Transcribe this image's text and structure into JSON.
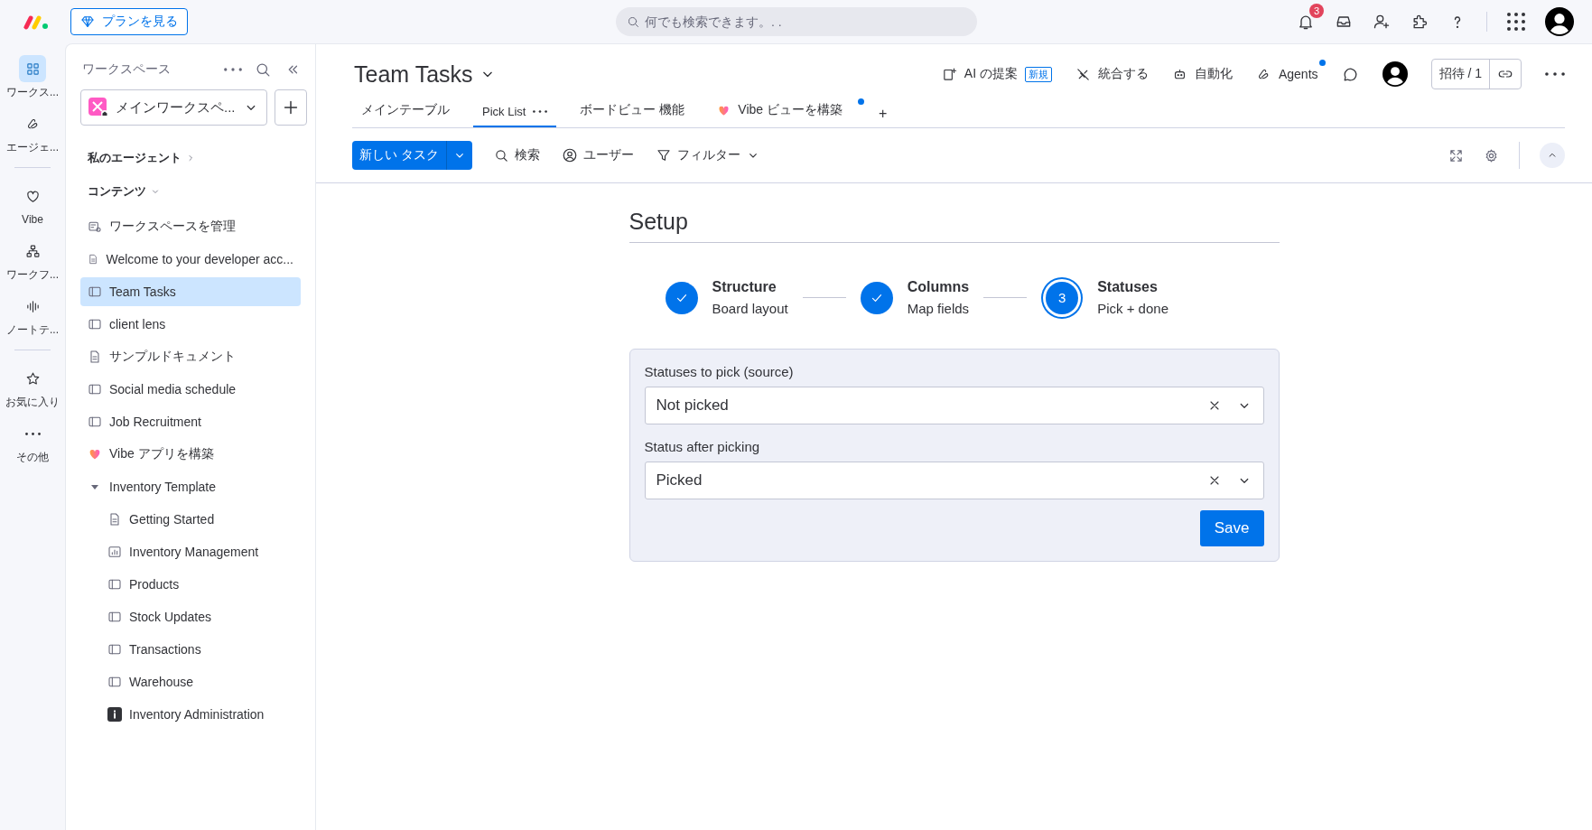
{
  "topbar": {
    "plans_button": "プランを見る",
    "search": {
      "placeholder": "何でも検索できます。. ."
    },
    "notification_count": "3"
  },
  "rail": [
    {
      "label": "ワークス...",
      "kind": "workspace",
      "selected": true
    },
    {
      "label": "エージェ...",
      "kind": "agents",
      "selected": false
    },
    {
      "label": "Vibe",
      "kind": "vibe",
      "selected": false
    },
    {
      "label": "ワークフ...",
      "kind": "workflows",
      "selected": false
    },
    {
      "label": "ノートテ...",
      "kind": "notetaker",
      "selected": false
    },
    {
      "label": "お気に入り",
      "kind": "favorites",
      "selected": false
    },
    {
      "label": "その他",
      "kind": "more",
      "selected": false
    }
  ],
  "sidebar": {
    "title": "ワークスペース",
    "workspace": "メインワークスペ...",
    "sections": [
      {
        "label": "私のエージェント",
        "expanded": false
      },
      {
        "label": "コンテンツ",
        "expanded": true
      }
    ],
    "items": [
      {
        "label": "ワークスペースを管理",
        "kind": "manage",
        "selected": false
      },
      {
        "label": "Welcome to your developer acc...",
        "kind": "doc",
        "selected": false
      },
      {
        "label": "Team Tasks",
        "kind": "board",
        "selected": true
      },
      {
        "label": "client lens",
        "kind": "board",
        "selected": false
      },
      {
        "label": "サンプルドキュメント",
        "kind": "doc",
        "selected": false
      },
      {
        "label": "Social media schedule",
        "kind": "board",
        "selected": false
      },
      {
        "label": "Job Recruitment",
        "kind": "board",
        "selected": false
      },
      {
        "label": "Vibe アプリを構築",
        "kind": "vibe",
        "selected": false
      },
      {
        "label": "Inventory Template",
        "kind": "folder",
        "selected": false,
        "expanded": true,
        "children": [
          {
            "label": "Getting Started",
            "kind": "doc",
            "selected": false
          },
          {
            "label": "Inventory Management",
            "kind": "dashboard",
            "selected": false
          },
          {
            "label": "Products",
            "kind": "board",
            "selected": false
          },
          {
            "label": "Stock Updates",
            "kind": "board",
            "selected": false
          },
          {
            "label": "Transactions",
            "kind": "board",
            "selected": false
          },
          {
            "label": "Warehouse",
            "kind": "board",
            "selected": false
          },
          {
            "label": "Inventory Administration",
            "kind": "app",
            "selected": false
          }
        ]
      }
    ]
  },
  "header": {
    "title": "Team Tasks",
    "actions": [
      {
        "label": "AI の提案",
        "kind": "ai",
        "badge": "新規",
        "unread": false
      },
      {
        "label": "統合する",
        "kind": "integrate",
        "unread": false
      },
      {
        "label": "自動化",
        "kind": "automate",
        "unread": false
      },
      {
        "label": "Agents",
        "kind": "agents",
        "unread": true
      }
    ],
    "invite": "招待 / 1",
    "tabs": [
      {
        "label": "メインテーブル",
        "kind": "plain",
        "selected": false,
        "unread": false
      },
      {
        "label": "Pick List",
        "kind": "menu",
        "selected": true,
        "unread": false
      },
      {
        "label": "ボードビュー 機能",
        "kind": "plain",
        "selected": false,
        "unread": false
      },
      {
        "label": "Vibe ビューを構築",
        "kind": "vibe",
        "selected": false,
        "unread": true
      }
    ],
    "add_tab": "+",
    "toolbar": {
      "new_task": "新しい タスク",
      "search": "検索",
      "person": "ユーザー",
      "filter": "フィルター"
    }
  },
  "setup": {
    "title": "Setup",
    "steps": [
      {
        "title": "Structure",
        "subtitle": "Board layout",
        "done": true,
        "selected": false
      },
      {
        "title": "Columns",
        "subtitle": "Map fields",
        "done": true,
        "selected": false
      },
      {
        "title": "Statuses",
        "subtitle": "Pick + done",
        "done": false,
        "selected": true,
        "number": "3"
      }
    ],
    "fields": [
      {
        "label": "Statuses to pick (source)",
        "value": "Not picked"
      },
      {
        "label": "Status after picking",
        "value": "Picked"
      }
    ],
    "save": "Save"
  }
}
